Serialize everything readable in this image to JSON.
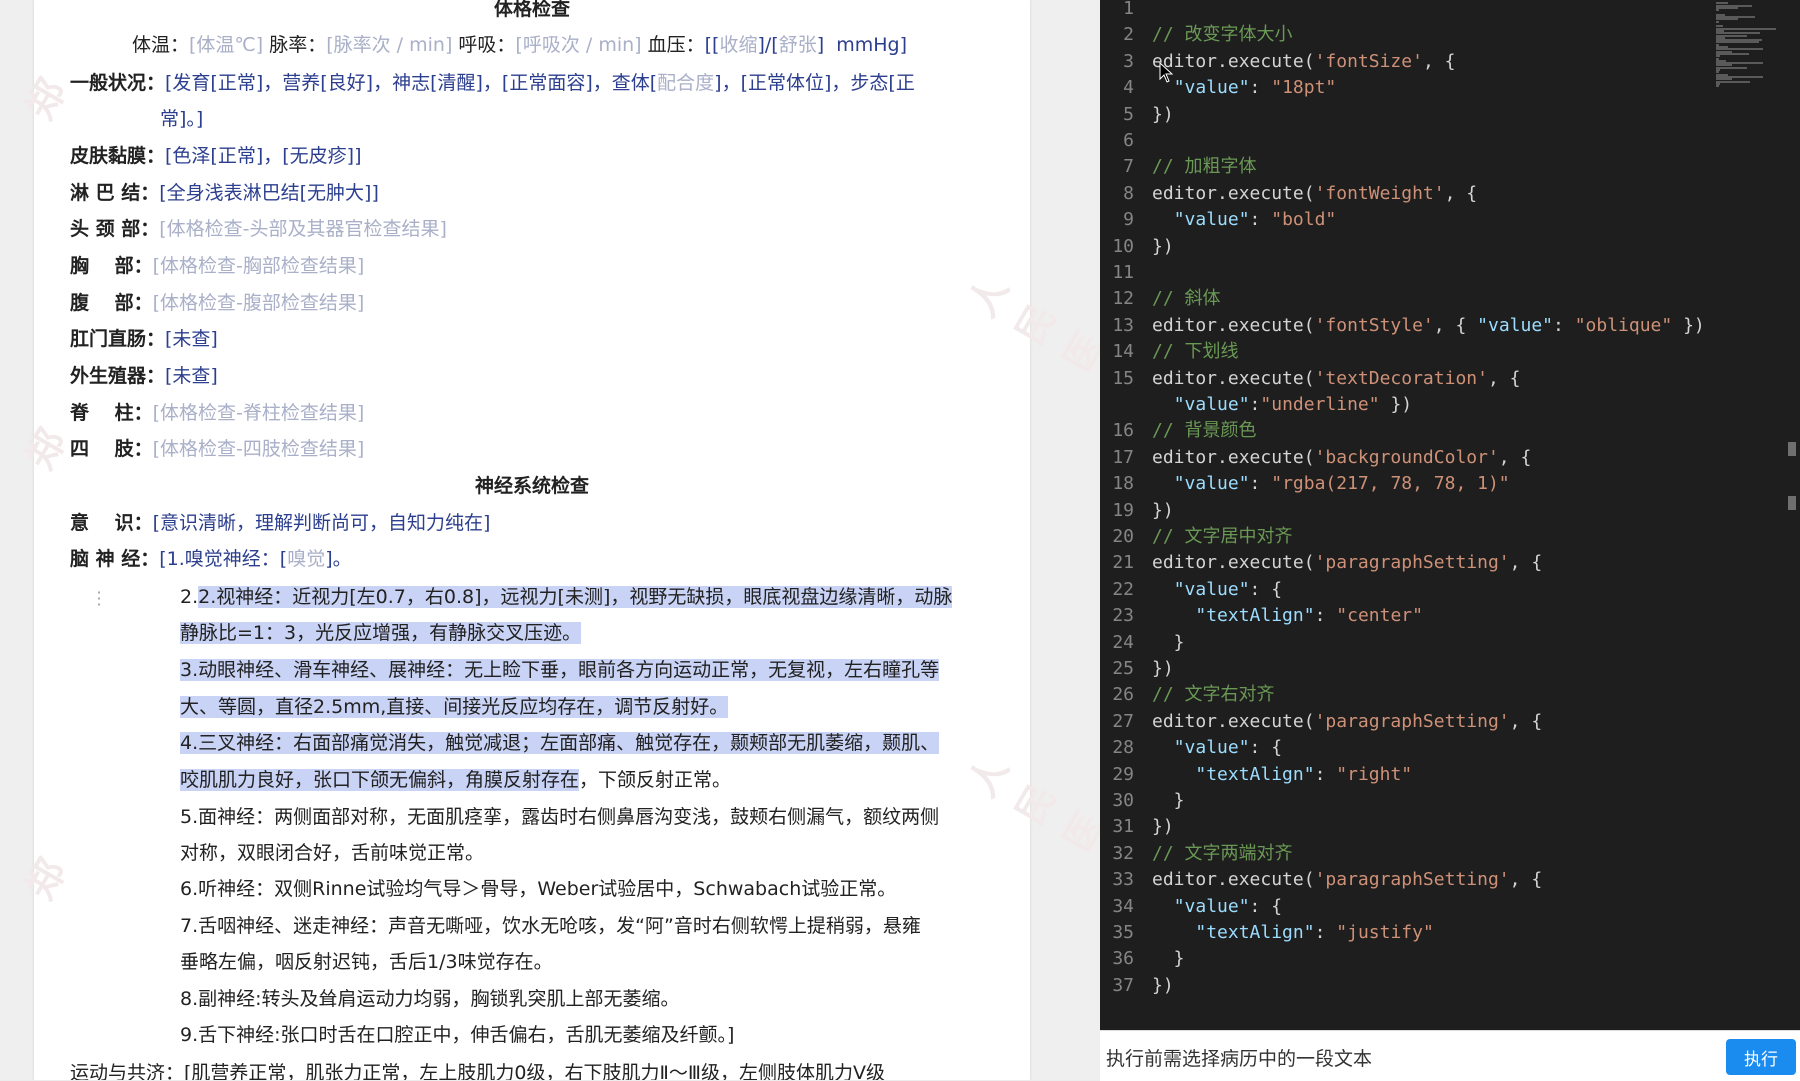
{
  "document": {
    "section_physical": "体格检查",
    "vitals": {
      "temp_label": "体温：",
      "temp_ph": "[体温℃]",
      "pulse_label": " 脉率：",
      "pulse_ph": "[脉率次 / min]",
      "resp_label": " 呼吸：",
      "resp_ph": "[呼吸次 / min]",
      "bp_label": " 血压：",
      "bp_value_open": "[[",
      "bp_sys": "收缩",
      "bp_mid": "]/[",
      "bp_dia": "舒张",
      "bp_close": "]",
      "bp_unit": "mmHg]"
    },
    "general_label": "一般状况：",
    "general_value_a": "[发育[正常]，营养[良好]，神志[清醒]，[正常面容]，查体[",
    "general_value_ph": "配合度",
    "general_value_b": "]，[正常体位]，步态[正",
    "general_value_c": "常]。]",
    "skin_label": "皮肤黏膜：",
    "skin_value": "[色泽[正常]，[无皮疹]]",
    "lymph_label": "淋 巴 结：",
    "lymph_value": "[全身浅表淋巴结[无肿大]]",
    "head_label": "头 颈 部：",
    "head_value": "[体格检查-头部及其器官检查结果]",
    "chest_label": "胸　 部：",
    "chest_value": "[体格检查-胸部检查结果]",
    "abdomen_label": "腹　 部：",
    "abdomen_value": "[体格检查-腹部检查结果]",
    "anus_label": "肛门直肠：",
    "anus_value": "[未查]",
    "genital_label": "外生殖器：",
    "genital_value": "[未查]",
    "spine_label": "脊　 柱：",
    "spine_value": "[体格检查-脊柱检查结果]",
    "limbs_label": "四　 肢：",
    "limbs_value": "[体格检查-四肢检查结果]",
    "section_neuro": "神经系统检查",
    "consciousness_label": "意　 识：",
    "consciousness_value": "[意识清晰，理解判断尚可，自知力纯在]",
    "cranial_label": "脑 神 经：",
    "cranial_value_a": "[1.嗅觉神经：[",
    "cranial_value_ph": "嗅觉",
    "cranial_value_b": "]。",
    "cn2_a": "2.视神经：近视力[左0.7，右0.8]，远视力[未测]，视野无缺损，眼底视盘边缘清晰，动脉",
    "cn2_b": "静脉比=1：3，光反应增强，有静脉交叉压迹。",
    "cn3_a": "3.动眼神经、滑车神经、展神经：无上睑下垂，眼前各方向运动正常，无复视，左右瞳孔等",
    "cn3_b": "大、等圆，直径2.5mm,直接、间接光反应均存在，调节反射好。",
    "cn5_a": "4.三叉神经：右面部痛觉消失，触觉减退；左面部痛、触觉存在，颞颊部无肌萎缩，颞肌、",
    "cn5_b_sel": "咬肌肌力良好，张口下颌无偏斜，角膜反射存在",
    "cn5_b_rest": "，下颌反射正常。",
    "cn7_a": "5.面神经：两侧面部对称，无面肌痉挛，露齿时右侧鼻唇沟变浅，鼓颊右侧漏气，额纹两侧",
    "cn7_b": "对称，双眼闭合好，舌前味觉正常。",
    "cn8": "6.听神经：双侧Rinne试验均气导＞骨导，Weber试验居中，Schwabach试验正常。",
    "cn9_a": "7.舌咽神经、迷走神经：声音无嘶哑，饮水无呛咳，发“阿”音时右侧软愕上提稍弱，悬雍",
    "cn9_b": "垂略左偏，咽反射迟钝，舌后1/3味觉存在。",
    "cn11": "8.副神经:转头及耸肩运动力均弱，胸锁乳突肌上部无萎缩。",
    "cn12": "9.舌下神经:张口时舌在口腔正中，伸舌偏右，舌肌无萎缩及纤颤。]",
    "motor_partial": "运动与共济：[肌营养正常，肌张力正常，左上肢肌力0级，右下肢肌力Ⅱ～Ⅲ级，左侧肢体肌力Ⅴ级"
  },
  "watermarks": [
    "郑",
    "人民医",
    "郑",
    "人民医",
    "郑"
  ],
  "code": {
    "lines": [
      {
        "n": "1",
        "parts": []
      },
      {
        "n": "2",
        "parts": [
          {
            "t": "// 改变字体大小",
            "c": "cm"
          }
        ]
      },
      {
        "n": "3",
        "parts": [
          {
            "t": "editor.execute(",
            "c": ""
          },
          {
            "t": "'fontSize'",
            "c": "st"
          },
          {
            "t": ", {",
            "c": ""
          }
        ]
      },
      {
        "n": "4",
        "parts": [
          {
            "t": "  ",
            "c": ""
          },
          {
            "t": "\"value\"",
            "c": "ky"
          },
          {
            "t": ": ",
            "c": ""
          },
          {
            "t": "\"18pt\"",
            "c": "st"
          }
        ]
      },
      {
        "n": "5",
        "parts": [
          {
            "t": "})",
            "c": ""
          }
        ]
      },
      {
        "n": "6",
        "parts": []
      },
      {
        "n": "7",
        "parts": [
          {
            "t": "// 加粗字体",
            "c": "cm"
          }
        ]
      },
      {
        "n": "8",
        "parts": [
          {
            "t": "editor.execute(",
            "c": ""
          },
          {
            "t": "'fontWeight'",
            "c": "st"
          },
          {
            "t": ", {",
            "c": ""
          }
        ]
      },
      {
        "n": "9",
        "parts": [
          {
            "t": "  ",
            "c": ""
          },
          {
            "t": "\"value\"",
            "c": "ky"
          },
          {
            "t": ": ",
            "c": ""
          },
          {
            "t": "\"bold\"",
            "c": "st"
          }
        ]
      },
      {
        "n": "10",
        "parts": [
          {
            "t": "})",
            "c": ""
          }
        ]
      },
      {
        "n": "11",
        "parts": []
      },
      {
        "n": "12",
        "parts": [
          {
            "t": "// 斜体",
            "c": "cm"
          }
        ]
      },
      {
        "n": "13",
        "parts": [
          {
            "t": "editor.execute(",
            "c": ""
          },
          {
            "t": "'fontStyle'",
            "c": "st"
          },
          {
            "t": ", { ",
            "c": ""
          },
          {
            "t": "\"value\"",
            "c": "ky"
          },
          {
            "t": ": ",
            "c": ""
          },
          {
            "t": "\"oblique\"",
            "c": "st"
          },
          {
            "t": " })",
            "c": ""
          }
        ]
      },
      {
        "n": "14",
        "parts": [
          {
            "t": "// 下划线",
            "c": "cm"
          }
        ]
      },
      {
        "n": "15",
        "parts": [
          {
            "t": "editor.execute(",
            "c": ""
          },
          {
            "t": "'textDecoration'",
            "c": "st"
          },
          {
            "t": ", {",
            "c": ""
          }
        ]
      },
      {
        "n": "",
        "parts": [
          {
            "t": "  ",
            "c": ""
          },
          {
            "t": "\"value\"",
            "c": "ky"
          },
          {
            "t": ":",
            "c": ""
          },
          {
            "t": "\"underline\"",
            "c": "st"
          },
          {
            "t": " })",
            "c": ""
          }
        ]
      },
      {
        "n": "16",
        "parts": [
          {
            "t": "// 背景颜色",
            "c": "cm"
          }
        ]
      },
      {
        "n": "17",
        "parts": [
          {
            "t": "editor.execute(",
            "c": ""
          },
          {
            "t": "'backgroundColor'",
            "c": "st"
          },
          {
            "t": ", {",
            "c": ""
          }
        ]
      },
      {
        "n": "18",
        "parts": [
          {
            "t": "  ",
            "c": ""
          },
          {
            "t": "\"value\"",
            "c": "ky"
          },
          {
            "t": ": ",
            "c": ""
          },
          {
            "t": "\"rgba(217, 78, 78, 1)\"",
            "c": "st"
          }
        ]
      },
      {
        "n": "19",
        "parts": [
          {
            "t": "})",
            "c": ""
          }
        ]
      },
      {
        "n": "20",
        "parts": [
          {
            "t": "// 文字居中对齐",
            "c": "cm"
          }
        ]
      },
      {
        "n": "21",
        "parts": [
          {
            "t": "editor.execute(",
            "c": ""
          },
          {
            "t": "'paragraphSetting'",
            "c": "st"
          },
          {
            "t": ", {",
            "c": ""
          }
        ]
      },
      {
        "n": "22",
        "parts": [
          {
            "t": "  ",
            "c": ""
          },
          {
            "t": "\"value\"",
            "c": "ky"
          },
          {
            "t": ": {",
            "c": ""
          }
        ]
      },
      {
        "n": "23",
        "parts": [
          {
            "t": "    ",
            "c": ""
          },
          {
            "t": "\"textAlign\"",
            "c": "ky"
          },
          {
            "t": ": ",
            "c": ""
          },
          {
            "t": "\"center\"",
            "c": "st"
          }
        ]
      },
      {
        "n": "24",
        "parts": [
          {
            "t": "  }",
            "c": ""
          }
        ]
      },
      {
        "n": "25",
        "parts": [
          {
            "t": "})",
            "c": ""
          }
        ]
      },
      {
        "n": "26",
        "parts": [
          {
            "t": "// 文字右对齐",
            "c": "cm"
          }
        ]
      },
      {
        "n": "27",
        "parts": [
          {
            "t": "editor.execute(",
            "c": ""
          },
          {
            "t": "'paragraphSetting'",
            "c": "st"
          },
          {
            "t": ", {",
            "c": ""
          }
        ]
      },
      {
        "n": "28",
        "parts": [
          {
            "t": "  ",
            "c": ""
          },
          {
            "t": "\"value\"",
            "c": "ky"
          },
          {
            "t": ": {",
            "c": ""
          }
        ]
      },
      {
        "n": "29",
        "parts": [
          {
            "t": "    ",
            "c": ""
          },
          {
            "t": "\"textAlign\"",
            "c": "ky"
          },
          {
            "t": ": ",
            "c": ""
          },
          {
            "t": "\"right\"",
            "c": "st"
          }
        ]
      },
      {
        "n": "30",
        "parts": [
          {
            "t": "  }",
            "c": ""
          }
        ]
      },
      {
        "n": "31",
        "parts": [
          {
            "t": "})",
            "c": ""
          }
        ]
      },
      {
        "n": "32",
        "parts": [
          {
            "t": "// 文字两端对齐",
            "c": "cm"
          }
        ]
      },
      {
        "n": "33",
        "parts": [
          {
            "t": "editor.execute(",
            "c": ""
          },
          {
            "t": "'paragraphSetting'",
            "c": "st"
          },
          {
            "t": ", {",
            "c": ""
          }
        ]
      },
      {
        "n": "34",
        "parts": [
          {
            "t": "  ",
            "c": ""
          },
          {
            "t": "\"value\"",
            "c": "ky"
          },
          {
            "t": ": {",
            "c": ""
          }
        ]
      },
      {
        "n": "35",
        "parts": [
          {
            "t": "    ",
            "c": ""
          },
          {
            "t": "\"textAlign\"",
            "c": "ky"
          },
          {
            "t": ": ",
            "c": ""
          },
          {
            "t": "\"justify\"",
            "c": "st"
          }
        ]
      },
      {
        "n": "36",
        "parts": [
          {
            "t": "  }",
            "c": ""
          }
        ]
      },
      {
        "n": "37",
        "parts": [
          {
            "t": "})",
            "c": ""
          }
        ]
      }
    ]
  },
  "action_bar": {
    "hint": "执行前需选择病历中的一段文本",
    "run_label": "执行"
  },
  "colors": {
    "selection": "#c9d3f5",
    "field_bracket": "#2c3f8f",
    "placeholder": "#a9b0c8",
    "run_button": "#1a8cf0",
    "editor_bg": "#1e1e1e"
  }
}
